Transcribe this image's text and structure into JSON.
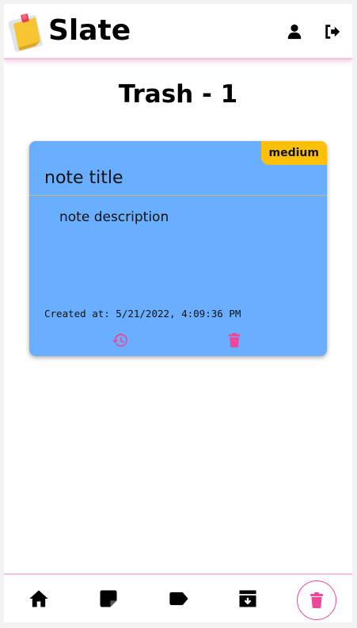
{
  "header": {
    "brand": "Slate",
    "icons": {
      "logo": "sticky-note-logo-icon",
      "user": "user-icon",
      "logout": "logout-icon"
    }
  },
  "page": {
    "title_prefix": "Trash",
    "title_separator": " - ",
    "trash_count": "1"
  },
  "notes": [
    {
      "priority": "medium",
      "title": "note title",
      "description": "note description",
      "created_at": "Created at: 5/21/2022, 4:09:36 PM",
      "color": "#6aafff",
      "actions": [
        "restore-icon",
        "trash-icon"
      ]
    }
  ],
  "bottom_nav": {
    "items": [
      "home-icon",
      "notes-icon",
      "label-icon",
      "archive-icon",
      "trash-icon"
    ],
    "active": "trash-icon"
  },
  "colors": {
    "accent": "#ec4899",
    "header_border": "#f6c1dc",
    "priority_medium": "#ffc107"
  }
}
